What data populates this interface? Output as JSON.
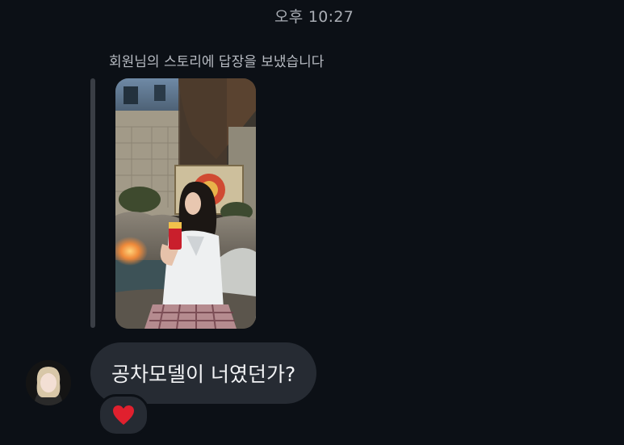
{
  "thread": {
    "timestamp": "오후 10:27",
    "story_reply_caption": "회원님의 스토리에 답장을 보냈습니다"
  },
  "story": {
    "icon": "story-photo"
  },
  "message": {
    "text": "공차모델이 너였던가?",
    "reaction": "heart"
  },
  "colors": {
    "background": "#0c1016",
    "bubble": "#262b33",
    "reaction_heart": "#e0202e",
    "quote_bar": "#3a3e45"
  }
}
